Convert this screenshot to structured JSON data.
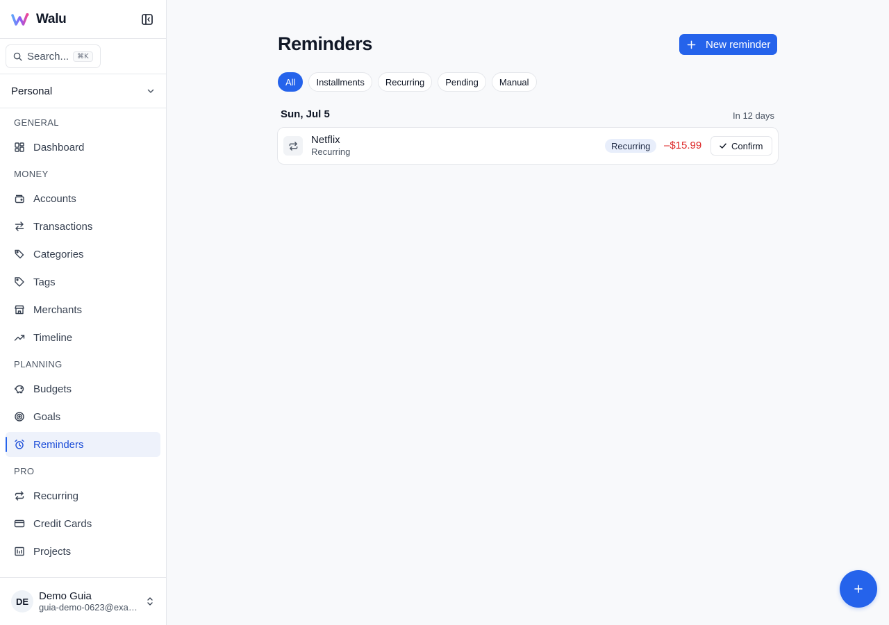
{
  "app": {
    "name": "Walu"
  },
  "search": {
    "label": "Search...",
    "shortcut": "⌘K"
  },
  "workspace": {
    "selected": "Personal"
  },
  "sidebar": {
    "sections": [
      {
        "label": "GENERAL",
        "items": [
          {
            "label": "Dashboard",
            "icon": "dashboard-icon"
          }
        ]
      },
      {
        "label": "MONEY",
        "items": [
          {
            "label": "Accounts",
            "icon": "wallet-icon"
          },
          {
            "label": "Transactions",
            "icon": "transfer-arrows-icon"
          },
          {
            "label": "Categories",
            "icon": "tags-icon"
          },
          {
            "label": "Tags",
            "icon": "tag-icon"
          },
          {
            "label": "Merchants",
            "icon": "store-icon"
          },
          {
            "label": "Timeline",
            "icon": "trending-up-icon"
          }
        ]
      },
      {
        "label": "PLANNING",
        "items": [
          {
            "label": "Budgets",
            "icon": "piggy-bank-icon"
          },
          {
            "label": "Goals",
            "icon": "target-icon"
          },
          {
            "label": "Reminders",
            "icon": "alarm-clock-icon",
            "active": true
          }
        ]
      },
      {
        "label": "PRO",
        "items": [
          {
            "label": "Recurring",
            "icon": "repeat-icon"
          },
          {
            "label": "Credit Cards",
            "icon": "credit-card-icon"
          },
          {
            "label": "Projects",
            "icon": "projects-chart-icon"
          }
        ]
      }
    ]
  },
  "user": {
    "initials": "DE",
    "name": "Demo Guia",
    "email": "guia-demo-0623@example.com"
  },
  "main": {
    "title": "Reminders",
    "new_button": "New reminder",
    "filters": [
      {
        "label": "All",
        "active": true
      },
      {
        "label": "Installments"
      },
      {
        "label": "Recurring"
      },
      {
        "label": "Pending"
      },
      {
        "label": "Manual"
      }
    ],
    "groups": [
      {
        "date": "Sun, Jul 5",
        "relative": "In 12 days",
        "reminders": [
          {
            "title": "Netflix",
            "subtitle": "Recurring",
            "badge": "Recurring",
            "amount": "–$15.99",
            "confirm_label": "Confirm"
          }
        ]
      }
    ]
  },
  "colors": {
    "accent": "#2563eb",
    "negative": "#dc2626",
    "active_bg": "#eef2fb"
  }
}
